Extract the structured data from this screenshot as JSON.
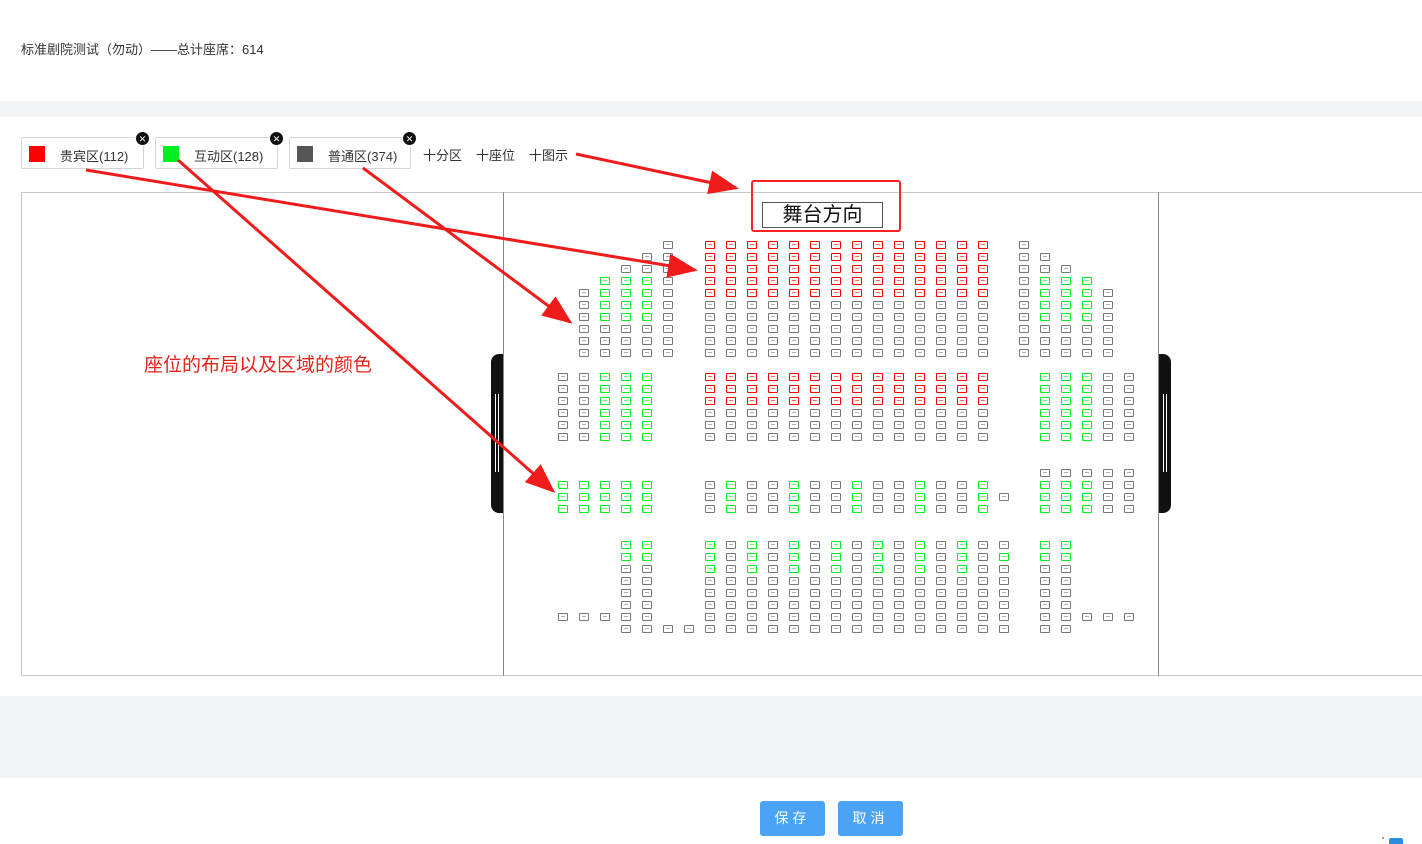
{
  "header": {
    "title": "标准剧院测试（勿动）——总计座席：614"
  },
  "zones": [
    {
      "label": "贵宾区(112)",
      "color": "#ff0000",
      "close_icon": "close-circle-icon"
    },
    {
      "label": "互动区(128)",
      "color": "#00ee22",
      "close_icon": "close-circle-icon"
    },
    {
      "label": "普通区(374)",
      "color": "#555555",
      "close_icon": "close-circle-icon"
    }
  ],
  "actions": {
    "add_zone": "十分区",
    "add_seat": "十座位",
    "add_legend": "十图示"
  },
  "stage": {
    "label": "舞台方向"
  },
  "annotation": {
    "text": "座位的布局以及区域的颜色"
  },
  "footer": {
    "save": "保存",
    "cancel": "取消"
  },
  "colors": {
    "vip": "#ff0000",
    "interactive": "#00ee22",
    "normal": "#777777",
    "arrow": "#f01c1c",
    "primary": "#4aa3f5"
  }
}
